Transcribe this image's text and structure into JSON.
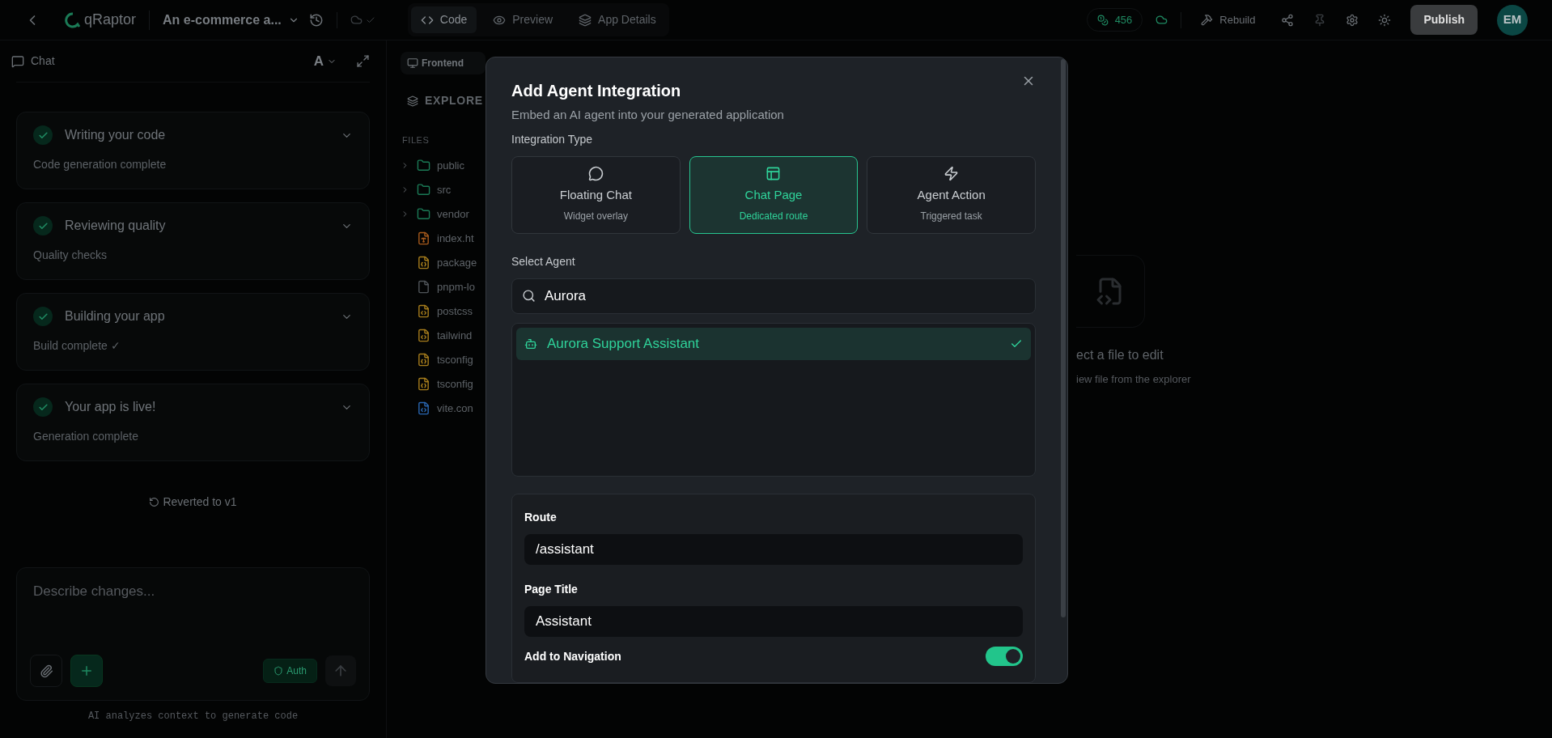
{
  "top_bar": {
    "logo": "qRaptor",
    "project_title": "An e-commerce a...",
    "view_tabs": [
      {
        "label": "Code",
        "selected": true
      },
      {
        "label": "Preview",
        "selected": false
      },
      {
        "label": "App Details",
        "selected": false
      }
    ],
    "credits": "456",
    "rebuild": "Rebuild",
    "publish": "Publish",
    "avatar": "EM"
  },
  "chat": {
    "title": "Chat",
    "font_button": "A",
    "steps": [
      {
        "title": "Writing your code",
        "detail": "Code generation complete",
        "done": true
      },
      {
        "title": "Reviewing quality",
        "detail": "Quality checks",
        "done": true
      },
      {
        "title": "Building your app",
        "detail": "Build complete ✓",
        "done": true
      },
      {
        "title": "Your app is live!",
        "detail": "Generation complete",
        "done": true
      }
    ],
    "revert_note": "Reverted to v1",
    "input": {
      "placeholder": "Describe changes..."
    },
    "auth_chip": "Auth",
    "footer": "AI analyzes context to generate code"
  },
  "explorer": {
    "frontend_tab": "Frontend",
    "title": "EXPLORE",
    "section": "FILES",
    "files": [
      {
        "name": "public",
        "kind": "folder",
        "color": "#1b7a56"
      },
      {
        "name": "src",
        "kind": "folder",
        "color": "#1b7a56"
      },
      {
        "name": "vendor",
        "kind": "folder",
        "color": "#1b7a56"
      },
      {
        "name": "index.ht",
        "kind": "html",
        "color": "#a65a1c"
      },
      {
        "name": "package",
        "kind": "json",
        "color": "#a67d1c"
      },
      {
        "name": "pnpm-lo",
        "kind": "plain",
        "color": "#50555a"
      },
      {
        "name": "postcss",
        "kind": "code",
        "color": "#a67d1c"
      },
      {
        "name": "tailwind",
        "kind": "code",
        "color": "#a67d1c"
      },
      {
        "name": "tsconfig",
        "kind": "json",
        "color": "#a67d1c"
      },
      {
        "name": "tsconfig",
        "kind": "json",
        "color": "#a67d1c"
      },
      {
        "name": "vite.con",
        "kind": "code",
        "color": "#2a66b0"
      }
    ]
  },
  "editor_empty": {
    "title": "ect a file to edit",
    "hint": "iew file from the explorer"
  },
  "dialog": {
    "title": "Add Agent Integration",
    "subtitle": "Embed an AI agent into your generated application",
    "type_label": "Integration Type",
    "types": [
      {
        "title": "Floating Chat",
        "detail": "Widget overlay",
        "selected": false
      },
      {
        "title": "Chat Page",
        "detail": "Dedicated route",
        "selected": true
      },
      {
        "title": "Agent Action",
        "detail": "Triggered task",
        "selected": false
      }
    ],
    "agent_label": "Select Agent",
    "search": {
      "value": "Aurora"
    },
    "agents": [
      {
        "name": "Aurora Support Assistant",
        "selected": true
      }
    ],
    "route": {
      "label": "Route",
      "value": "/assistant"
    },
    "page_title": {
      "label": "Page Title",
      "value": "Assistant"
    },
    "add_to_nav": {
      "label": "Add to Navigation",
      "on": true
    }
  }
}
